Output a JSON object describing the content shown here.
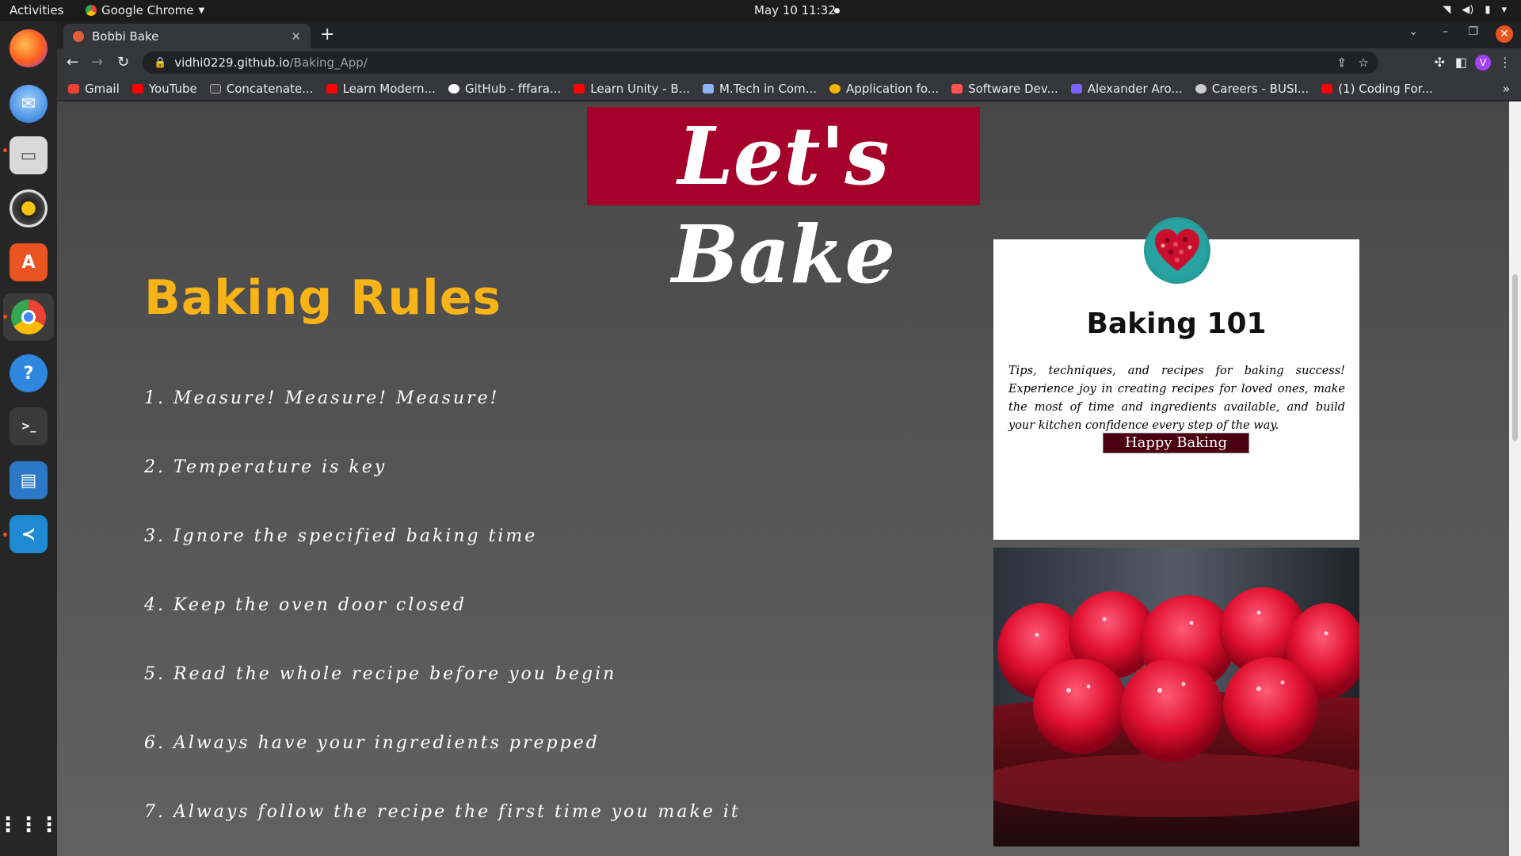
{
  "system": {
    "activities": "Activities",
    "app_menu": "Google Chrome",
    "clock": "May 10  11:32"
  },
  "browser": {
    "tab_title": "Bobbi Bake",
    "url_host": "vidhi0229.github.io",
    "url_path": "/Baking_App/",
    "profile_initial": "V",
    "bookmarks": [
      {
        "label": "Gmail",
        "color": "#ea4335"
      },
      {
        "label": "YouTube",
        "color": "#ff0000"
      },
      {
        "label": "Concatenate...",
        "color": "#444444"
      },
      {
        "label": "Learn Modern...",
        "color": "#ff0000"
      },
      {
        "label": "GitHub - fffara...",
        "color": "#ffffff"
      },
      {
        "label": "Learn Unity - B...",
        "color": "#ff0000"
      },
      {
        "label": "M.Tech in Com...",
        "color": "#8ab4f8"
      },
      {
        "label": "Application fo...",
        "color": "#f4b400"
      },
      {
        "label": "Software Dev...",
        "color": "#ff5252"
      },
      {
        "label": "Alexander Aro...",
        "color": "#7b61ff"
      },
      {
        "label": "Careers - BUSI...",
        "color": "#cccccc"
      },
      {
        "label": "(1) Coding For...",
        "color": "#ff0000"
      }
    ]
  },
  "page": {
    "banner": "Let's Bake",
    "rules_title": "Baking Rules",
    "rules": [
      "1. Measure! Measure! Measure!",
      "2. Temperature is key",
      "3. Ignore the specified baking time",
      "4. Keep the oven door closed",
      "5. Read the whole recipe before you begin",
      "6. Always have your ingredients prepped",
      "7. Always follow the recipe the first time you make it"
    ],
    "card": {
      "title": "Baking 101",
      "text": "Tips, techniques, and recipes for baking success! Experience joy in creating recipes for loved ones, make the most of time and ingredients available, and build your kitchen confidence every step of the way.",
      "button": "Happy Baking"
    },
    "colors": {
      "banner_bg": "#a50029",
      "rules_title": "#f8b416",
      "button_bg": "#4a0010"
    }
  }
}
